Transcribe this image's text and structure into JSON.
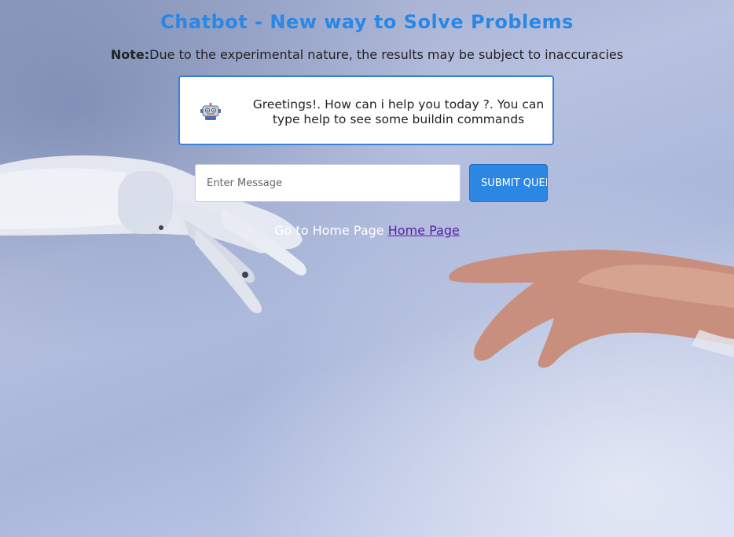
{
  "header": {
    "title": "Chatbot - New way to Solve Problems"
  },
  "note": {
    "label": "Note:",
    "text": "Due to the experimental nature, the results may be subject to inaccuracies"
  },
  "chat": {
    "bot_icon": "robot-icon",
    "messages": [
      {
        "sender": "bot",
        "text": "Greetings!. How can i help you today ?. You can type help to see some buildin commands"
      }
    ]
  },
  "composer": {
    "placeholder": "Enter Message",
    "value": "",
    "submit_label": "SUBMIT QUERY"
  },
  "footer": {
    "prefix": "Go to Home Page",
    "link_label": "Home Page"
  },
  "colors": {
    "accent": "#2b87e3",
    "link": "#5a1ea8",
    "chat_border": "#3b82d6"
  }
}
